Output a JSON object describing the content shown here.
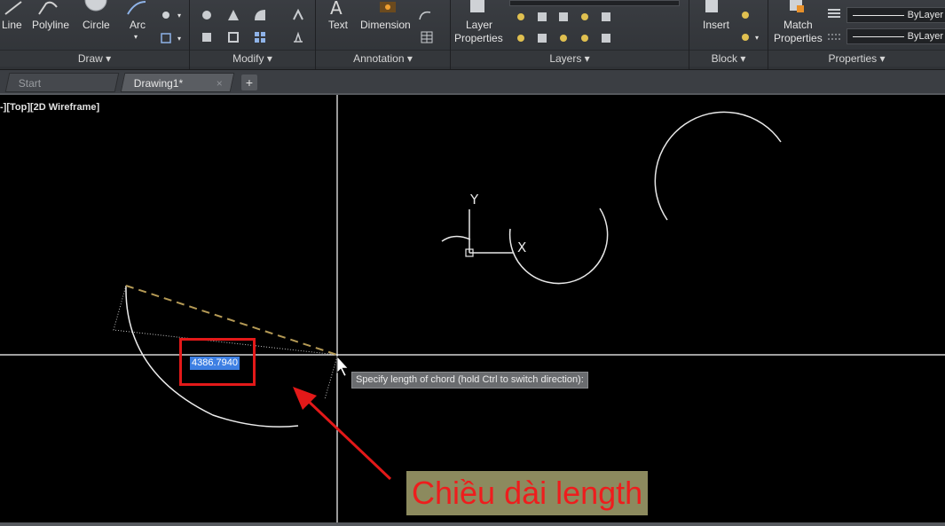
{
  "ribbon": {
    "draw": {
      "tools": [
        "Line",
        "Polyline",
        "Circle",
        "Arc"
      ],
      "title": "Draw ▾"
    },
    "modify": {
      "title": "Modify ▾"
    },
    "annotation": {
      "tools": [
        "Text",
        "Dimension"
      ],
      "title": "Annotation ▾"
    },
    "layers": {
      "tool_line1": "Layer",
      "tool_line2": "Properties",
      "title": "Layers ▾"
    },
    "block": {
      "tool": "Insert",
      "title": "Block ▾"
    },
    "properties": {
      "tool_line1": "Match",
      "tool_line2": "Properties",
      "bylayer1": "ByLayer",
      "bylayer2": "ByLayer",
      "title": "Properties ▾"
    }
  },
  "tabs": {
    "start": "Start",
    "drawing": "Drawing1*",
    "close_glyph": "×",
    "add_glyph": "+"
  },
  "viewport": {
    "label": "-][Top][2D Wireframe]",
    "ucs_y": "Y",
    "ucs_x": "X"
  },
  "command": {
    "input_value": "4386.7940",
    "tooltip": "Specify length of chord (hold Ctrl to switch direction):"
  },
  "annotation_overlay": {
    "callout_text": "Chiều dài length",
    "highlight_color": "#e31919",
    "callout_bg": "#8c8a5e"
  },
  "colors": {
    "ribbon_bg": "#2f3236",
    "canvas_bg": "#000000",
    "crosshair": "#ffffff",
    "chord_preview": "#b59a55",
    "input_highlight": "#3d7fe3"
  }
}
